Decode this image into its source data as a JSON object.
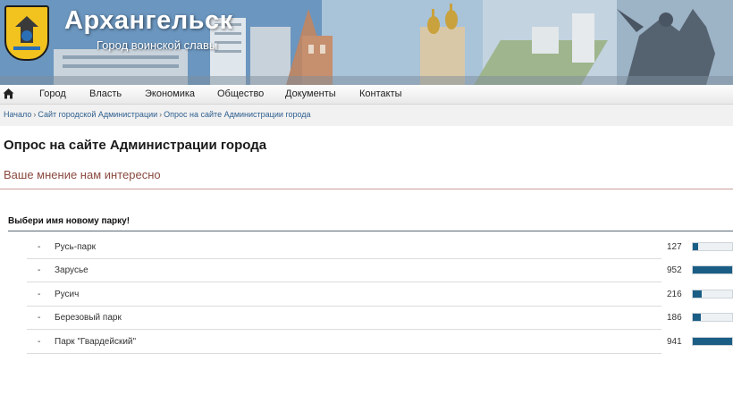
{
  "site": {
    "title": "Архангельск",
    "subtitle": "Город воинской славы"
  },
  "nav": {
    "home_icon": "home-icon",
    "items": [
      {
        "label": "Город"
      },
      {
        "label": "Власть"
      },
      {
        "label": "Экономика"
      },
      {
        "label": "Общество"
      },
      {
        "label": "Документы"
      },
      {
        "label": "Контакты"
      }
    ]
  },
  "breadcrumb": {
    "items": [
      {
        "label": "Начало"
      },
      {
        "label": "Сайт городской Администрации"
      },
      {
        "label": "Опрос на сайте Администрации города"
      }
    ],
    "separator": "›"
  },
  "page": {
    "title": "Опрос на сайте Администрации города",
    "subtitle": "Ваше мнение нам интересно"
  },
  "poll": {
    "question": "Выбери имя новому парку!",
    "dash": "-",
    "bar_color": "#1b5e85",
    "options": [
      {
        "label": "Русь-парк",
        "count": "127",
        "fraction": 0.13
      },
      {
        "label": "Зарусье",
        "count": "952",
        "fraction": 1.0
      },
      {
        "label": "Русич",
        "count": "216",
        "fraction": 0.23
      },
      {
        "label": "Березовый парк",
        "count": "186",
        "fraction": 0.2
      },
      {
        "label": "Парк \"Гвардейский\"",
        "count": "941",
        "fraction": 0.99
      }
    ]
  }
}
